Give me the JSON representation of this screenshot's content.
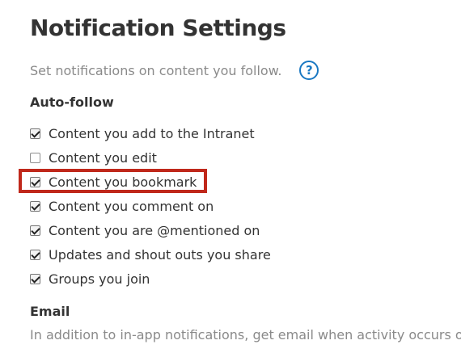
{
  "page": {
    "title": "Notification Settings",
    "intro": "Set notifications on content you follow.",
    "help_label": "?"
  },
  "auto_follow": {
    "heading": "Auto-follow",
    "items": [
      {
        "label": "Content you add to the Intranet",
        "checked": true
      },
      {
        "label": "Content you edit",
        "checked": false
      },
      {
        "label": "Content you bookmark",
        "checked": true,
        "highlighted": true
      },
      {
        "label": "Content you comment on",
        "checked": true
      },
      {
        "label": "Content you are @mentioned on",
        "checked": true
      },
      {
        "label": "Updates and shout outs you share",
        "checked": true
      },
      {
        "label": "Groups you join",
        "checked": true
      }
    ]
  },
  "email": {
    "heading": "Email",
    "description": "In addition to in-app notifications, get email when activity occurs on"
  },
  "colors": {
    "accent": "#1a78c2",
    "highlight": "#c0281b",
    "muted_text": "#8a8a8a"
  }
}
